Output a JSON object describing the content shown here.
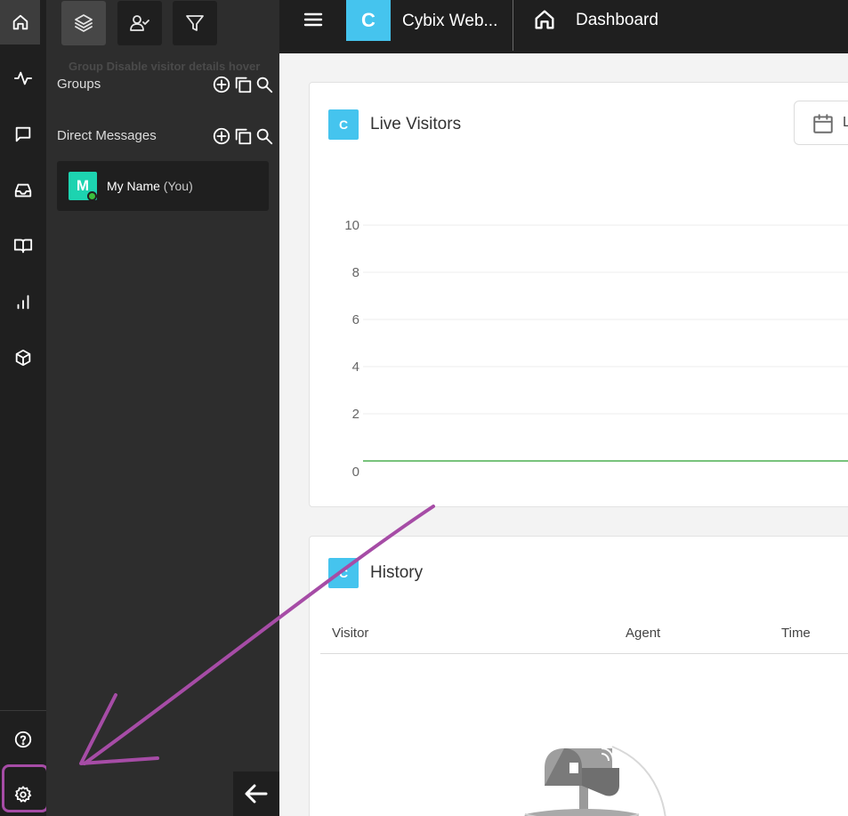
{
  "rail": {
    "items": [
      {
        "name": "home",
        "icon": "home-icon"
      },
      {
        "name": "activity",
        "icon": "activity-icon"
      },
      {
        "name": "chat",
        "icon": "chat-icon"
      },
      {
        "name": "inbox",
        "icon": "inbox-icon"
      },
      {
        "name": "knowledge-base",
        "icon": "book-icon"
      },
      {
        "name": "reports",
        "icon": "bar-chart-icon"
      },
      {
        "name": "integrations",
        "icon": "box-icon"
      }
    ],
    "bottom": [
      {
        "name": "help",
        "icon": "help-icon"
      },
      {
        "name": "settings",
        "icon": "gear-icon"
      }
    ]
  },
  "panel": {
    "tools": [
      "layers-icon",
      "user-check-icon",
      "filter-icon"
    ],
    "tooltip": "Group Disable visitor details hover",
    "groups_label": "Groups",
    "dm_label": "Direct Messages",
    "dm_user": {
      "initial": "M",
      "name": "My Name",
      "suffix": "(You)"
    }
  },
  "topbar": {
    "app_initial": "C",
    "app_title": "Cybix Web...",
    "page_title": "Dashboard"
  },
  "live_visitors": {
    "badge": "C",
    "title": "Live Visitors",
    "date_button_label": "L"
  },
  "chart_data": {
    "type": "line",
    "title": "Live Visitors",
    "xlabel": "",
    "ylabel": "",
    "ylim": [
      0,
      10
    ],
    "yticks": [
      0,
      2,
      4,
      6,
      8,
      10
    ],
    "grid": true,
    "series": [
      {
        "values": [
          0,
          0
        ],
        "color": "#4caf50"
      }
    ]
  },
  "history": {
    "badge": "C",
    "title": "History",
    "columns": [
      "Visitor",
      "Agent",
      "Time"
    ]
  },
  "colors": {
    "accent": "#45c4ee",
    "annotation": "#a64ca6",
    "online": "#3cbf3c",
    "avatar": "#1dd3b0"
  }
}
